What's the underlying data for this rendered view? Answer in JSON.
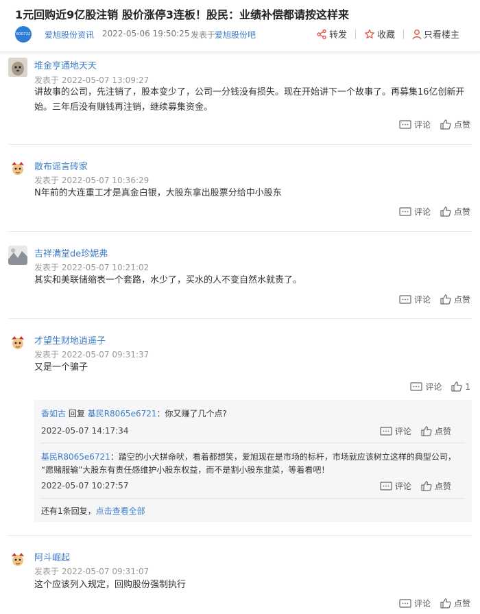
{
  "post": {
    "title": "1元回购近9亿股注销 股价涨停3连板！股民：业绩补偿都请按这样来",
    "stock_code": "600732",
    "author": "爱旭股份资讯",
    "time": "2022-05-06 19:50:25",
    "published_prefix": "发表于",
    "published_in": "爱旭股份吧",
    "actions": {
      "share": "转发",
      "favorite": "收藏",
      "only_op": "只看楼主"
    }
  },
  "labels": {
    "comment": "评论",
    "like": "点赞"
  },
  "comments": [
    {
      "name": "堆金亨通地天天",
      "time": "发表于 2022-05-07 13:09:27",
      "text": "讲故事的公司，先注销了，股本变少了，公司一分钱没有损失。现在开始讲下一个故事了。再募集16亿创新开始。三年后没有赚钱再注销，继续募集资金。"
    },
    {
      "name": "散布谣言砖家",
      "time": "发表于 2022-05-07 10:36:29",
      "text": "N年前的大连重工才是真金白银，大股东拿出股票分给中小股东"
    },
    {
      "name": "吉祥满堂de珍妮弗",
      "time": "发表于 2022-05-07 10:21:02",
      "text": "其实和美联储缩表一个套路，水少了，买水的人不变自然水就贵了。"
    },
    {
      "name": "才望生财地逍遥子",
      "time": "发表于 2022-05-07 09:31:37",
      "text": "又是一个骗子",
      "like_count": "1"
    },
    {
      "name": "阿斗崛起",
      "time": "发表于 2022-05-07 09:31:07",
      "text": "这个应该列入规定，回购股份强制执行"
    }
  ],
  "replies": [
    {
      "from": "香如古",
      "verb": "回复",
      "to": "基民R8065e6721",
      "text": "：你又赚了几个点?",
      "time": "2022-05-07 14:17:34"
    },
    {
      "from": "基民R8065e6721",
      "text": "：踏空的小犬拼命吠，看着都想笑，爱旭现在是市场的标杆，市场就应该树立这样的典型公司，",
      "text2": "“愿赌服输”大股东有责任感维护小股东权益，而不是割小股东韭菜，等着看吧！",
      "time": "2022-05-07 10:27:57"
    }
  ],
  "more_replies": {
    "count_text": "还有1条回复，",
    "link": "点击查看全部"
  },
  "colors": {
    "link": "#3d7cc9",
    "reply_bg": "#f5f6f8",
    "logo": "#2e7cd6"
  }
}
